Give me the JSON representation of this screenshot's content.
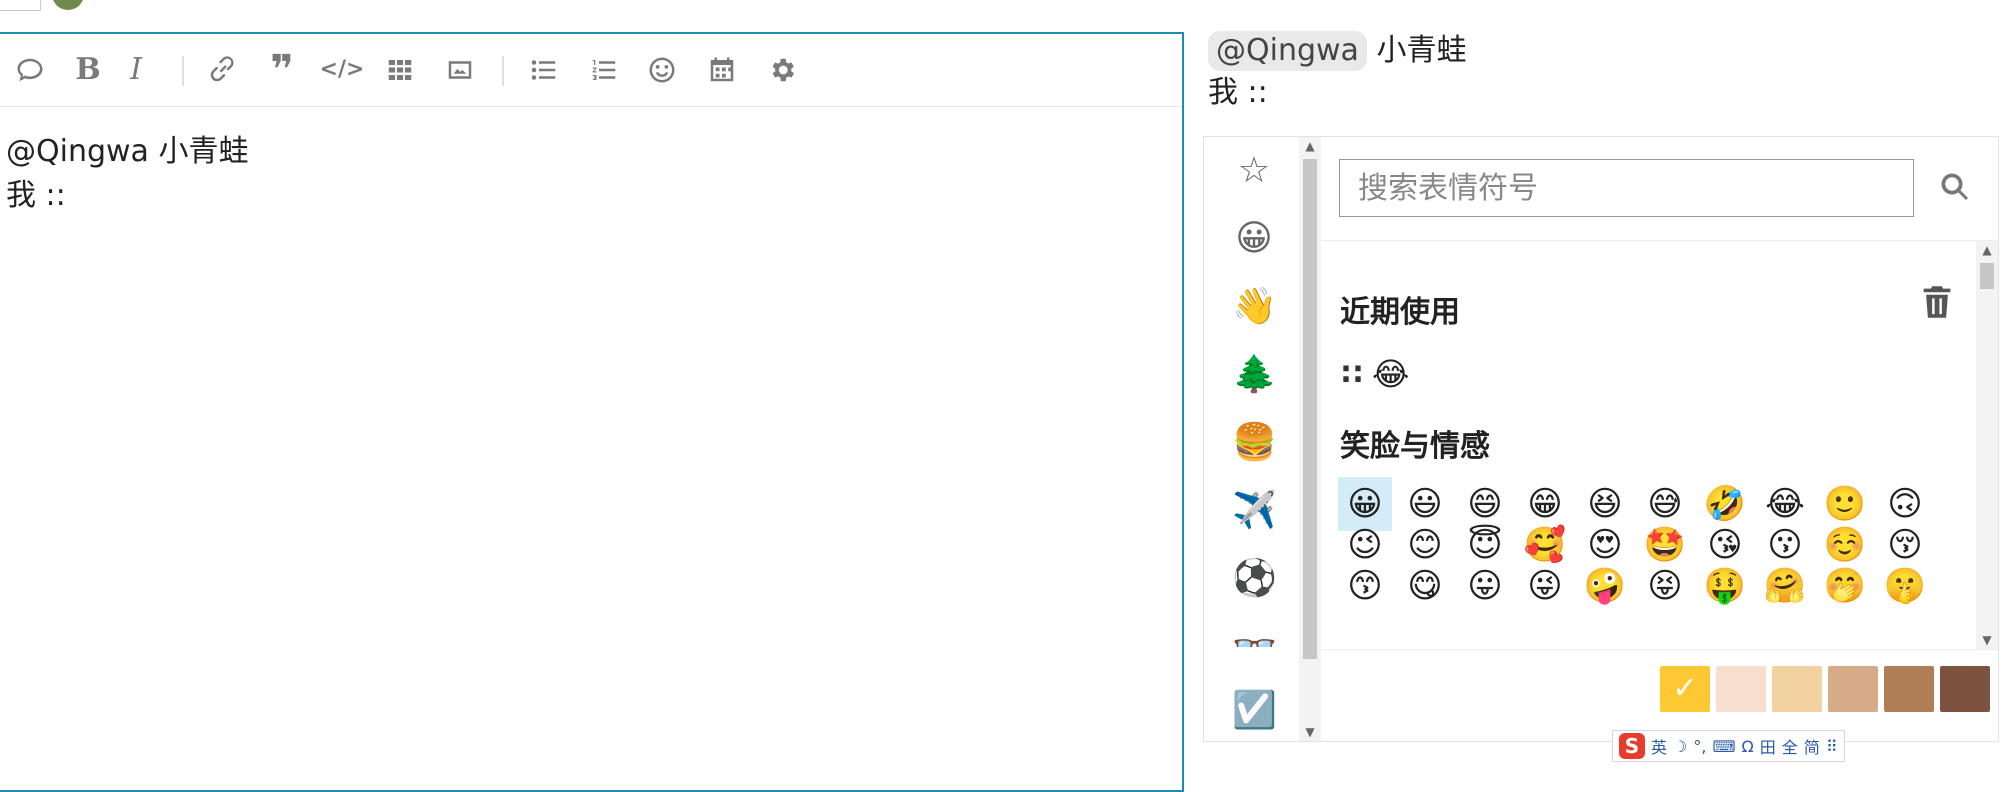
{
  "editor": {
    "toolbar": {
      "icons": [
        "chat-bubble",
        "bold",
        "italic",
        "link",
        "quote",
        "code",
        "table",
        "image",
        "bullet-list",
        "numbered-list",
        "emoji",
        "calendar",
        "settings"
      ],
      "bold_glyph": "B",
      "italic_glyph": "I",
      "quote_glyph": "❞",
      "code_glyph": "</>"
    },
    "content_line1": "@Qingwa 小青蛙",
    "content_line2": "我 ::"
  },
  "preview": {
    "mention": "@Qingwa",
    "mention_rest": " 小青蛙",
    "line2": "我 ::"
  },
  "emoji_picker": {
    "categories": [
      "☆",
      "😀",
      "👋",
      "🌲",
      "🍔",
      "✈️",
      "⚽",
      "👓",
      "☑️"
    ],
    "search": {
      "placeholder": "搜索表情符号",
      "value": ""
    },
    "sections": [
      {
        "title": "近期使用",
        "items": [
          "::",
          "😂"
        ]
      },
      {
        "title": "笑脸与情感",
        "items": [
          "😀",
          "😃",
          "😄",
          "😁",
          "😆",
          "😅",
          "🤣",
          "😂",
          "🙂",
          "🙃",
          "😉",
          "😊",
          "😇",
          "🥰",
          "😍",
          "🤩",
          "😘",
          "😗",
          "☺️",
          "😚",
          "😙",
          "😋",
          "😛",
          "😜",
          "🤪",
          "😝",
          "🤑",
          "🤗",
          "🤭",
          "🤫"
        ],
        "selected_index": 0
      }
    ],
    "skin_tones": [
      "#fcc934",
      "#f7dece",
      "#f3d2a2",
      "#d5ab88",
      "#af7e57",
      "#7c533e"
    ],
    "skin_tone_selected": 0
  },
  "ime_bar": {
    "logo": "S",
    "items": [
      "英",
      "☽",
      "°,",
      "⌨",
      "Ω",
      "田",
      "全",
      "简",
      "⠿"
    ]
  }
}
